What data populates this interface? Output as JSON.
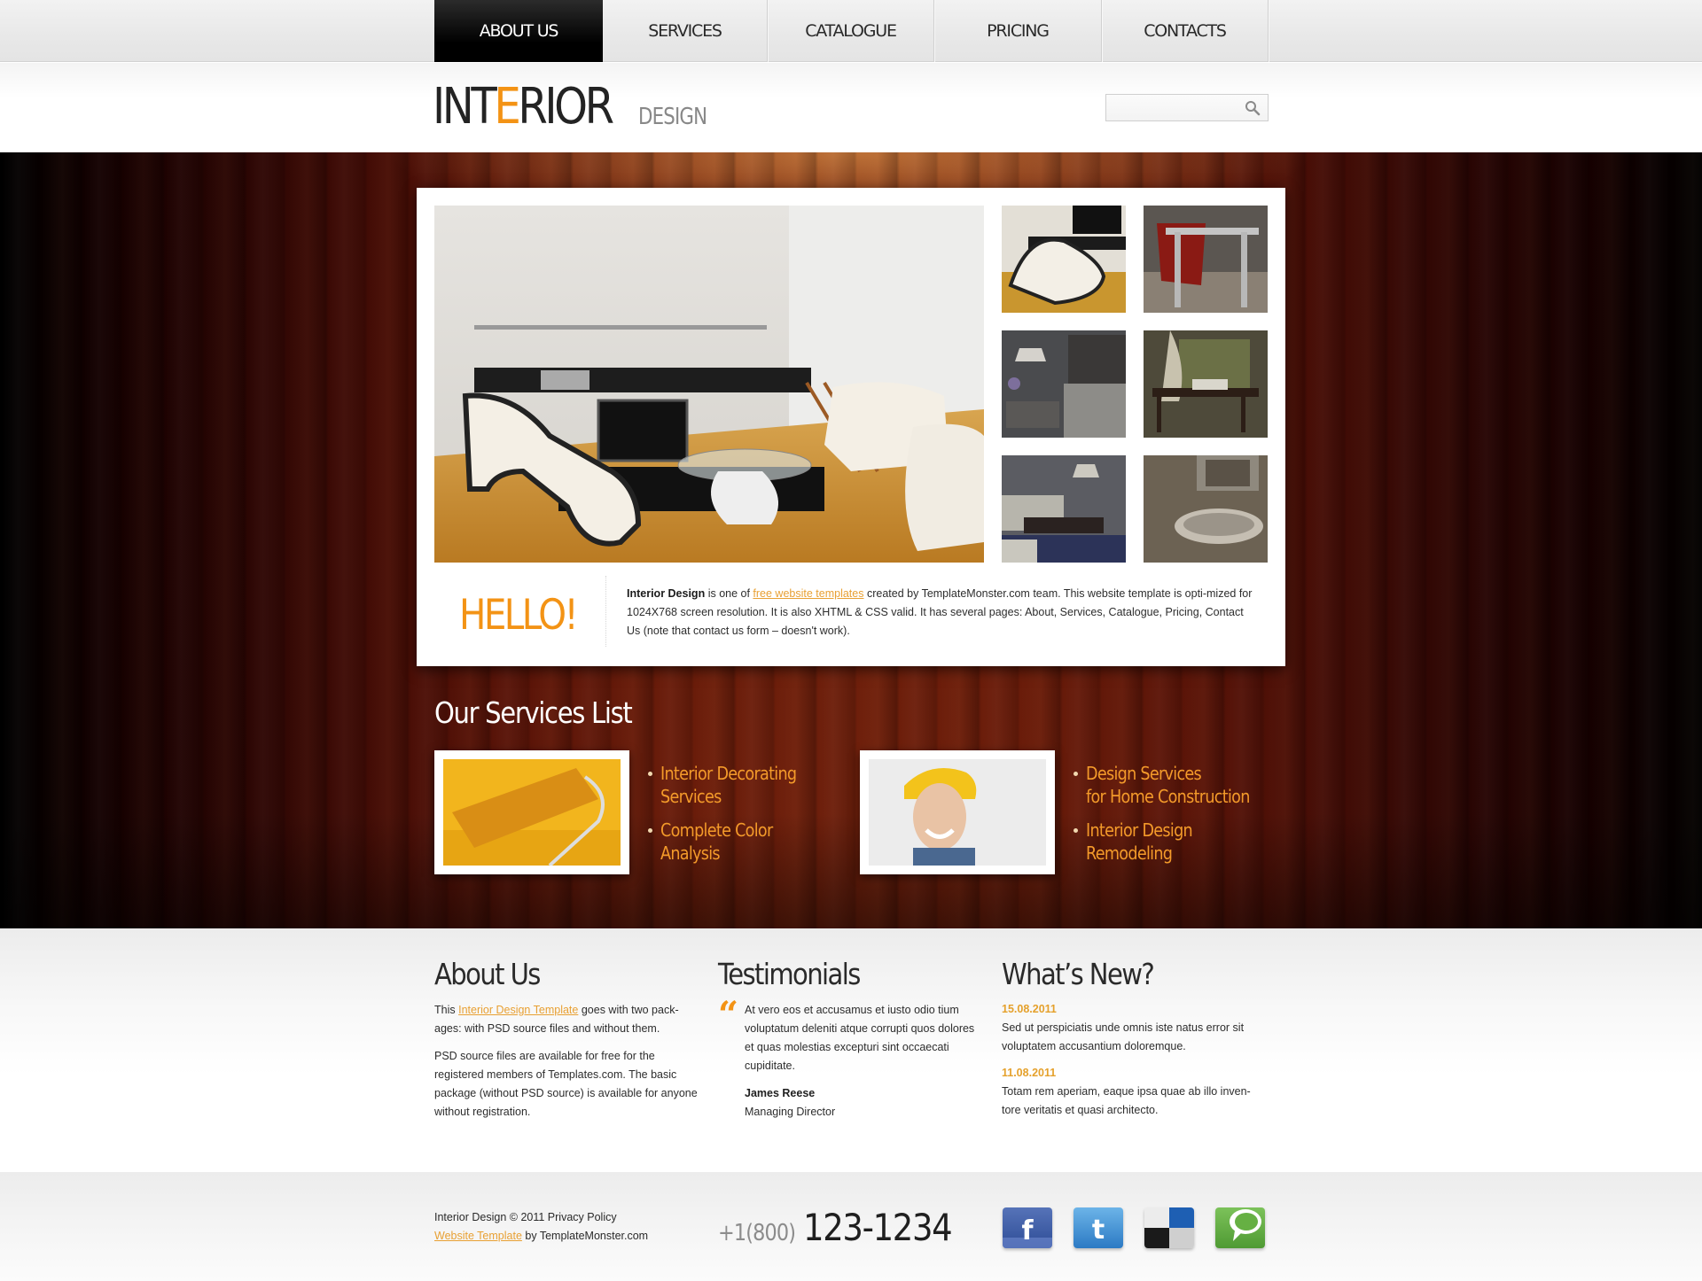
{
  "nav": {
    "items": [
      {
        "label": "ABOUT US",
        "active": true
      },
      {
        "label": "SERVICES",
        "active": false
      },
      {
        "label": "CATALOGUE",
        "active": false
      },
      {
        "label": "PRICING",
        "active": false
      },
      {
        "label": "CONTACTS",
        "active": false
      }
    ]
  },
  "header": {
    "logo_pre": "INT",
    "logo_accent": "E",
    "logo_post": "RIOR",
    "logo_sub": "DESIGN",
    "search": {
      "value": "",
      "placeholder": "",
      "icon": "search-icon"
    }
  },
  "feature": {
    "main_photo": "living room with white armchairs",
    "thumbnails": [
      "white armchair",
      "red chair with table",
      "bedroom with lamp",
      "canopy bed",
      "living room with sofa",
      "bathroom with tub"
    ],
    "hello": "HELLO!",
    "intro": {
      "bold": "Interior Design",
      "part1": " is one of ",
      "link": "free website templates",
      "part2": " created by TemplateMonster.com team. This website template is opti-mized for 1024X768 screen resolution. It is also XHTML & CSS valid. It has several pages: About, Services, Catalogue, Pricing, Contact Us (note that contact us form – doesn't work)."
    }
  },
  "services": {
    "title": "Our Services List",
    "groups": [
      {
        "image": "paint roller",
        "items": [
          "Interior Decorating\nServices",
          "Complete Color\nAnalysis"
        ]
      },
      {
        "image": "smiling worker in hard hat",
        "items": [
          "Design Services\nfor Home Construction",
          "Interior Design\nRemodeling"
        ]
      }
    ]
  },
  "about": {
    "title": "About Us",
    "p1_pre": "This ",
    "p1_link": "Interior Design Template",
    "p1_post": " goes with two pack-ages: with PSD source files and without them.",
    "p2": "PSD source files are available for free for the registered members of Templates.com. The basic package (without PSD source) is available for anyone without registration."
  },
  "testimonials": {
    "title": "Testimonials",
    "quote": "At vero eos et accusamus et iusto odio tium voluptatum deleniti atque corrupti quos dolores et quas molestias excepturi sint occaecati cupiditate.",
    "author": "James Reese",
    "role": "Managing Director"
  },
  "news": {
    "title": "What’s New?",
    "items": [
      {
        "date": "15.08.2011",
        "text": "Sed ut perspiciatis unde omnis iste natus error sit voluptatem accusantium doloremque."
      },
      {
        "date": "11.08.2011",
        "text": "Totam rem aperiam, eaque ipsa quae ab illo inven-tore veritatis et quasi architecto."
      }
    ]
  },
  "footer": {
    "line1": "Interior Design © 2011 Privacy Policy",
    "link": "Website Template",
    "line2_post": " by TemplateMonster.com",
    "phone_prefix": "+1(800)",
    "phone_number": "123-1234",
    "social": [
      "facebook-icon",
      "twitter-icon",
      "delicious-icon",
      "technorati-icon"
    ]
  },
  "colors": {
    "accent": "#f39315",
    "link": "#e8a033",
    "nav_active_bg": "#000000",
    "wood": "#6e1f0b"
  }
}
